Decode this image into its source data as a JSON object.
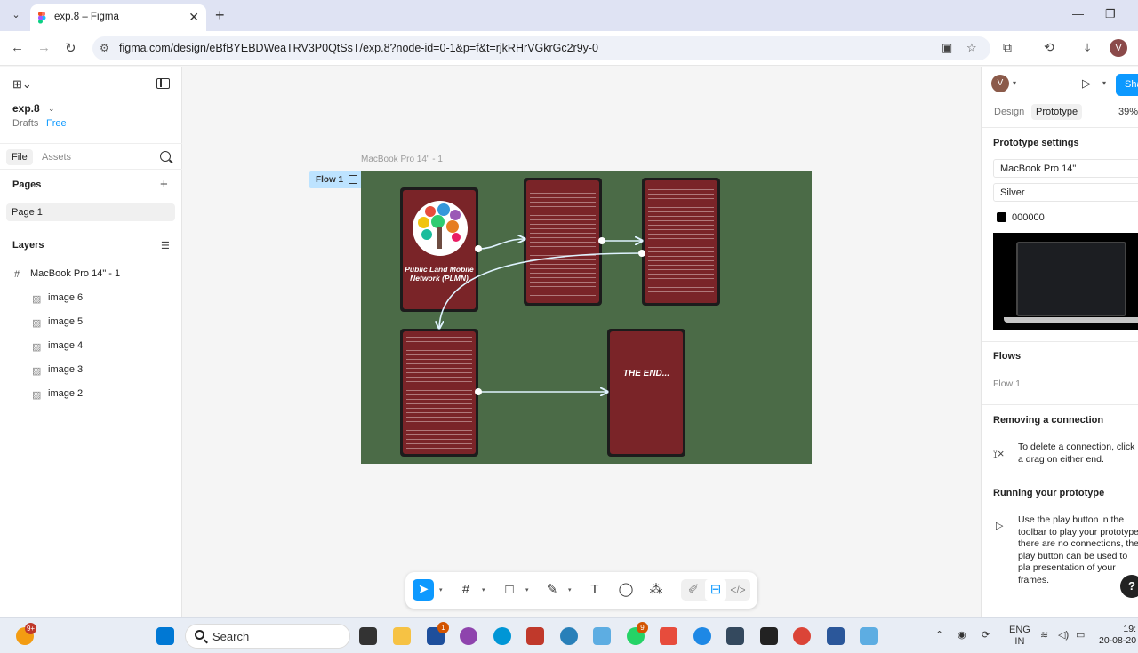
{
  "browser": {
    "tab_title": "exp.8 – Figma",
    "url": "figma.com/design/eBfBYEBDWeaTRV3P0QtSsT/exp.8?node-id=0-1&p=f&t=rjkRHrVGkrGc2r9y-0",
    "profile_initial": "V"
  },
  "left_panel": {
    "file_name": "exp.8",
    "drafts_label": "Drafts",
    "plan_badge": "Free",
    "tab_file": "File",
    "tab_assets": "Assets",
    "pages_heading": "Pages",
    "current_page": "Page 1",
    "layers_heading": "Layers",
    "layers": [
      {
        "name": "MacBook Pro 14\" - 1",
        "icon": "frame-icon"
      },
      {
        "name": "image 6",
        "icon": "image-icon"
      },
      {
        "name": "image 5",
        "icon": "image-icon"
      },
      {
        "name": "image 4",
        "icon": "image-icon"
      },
      {
        "name": "image 3",
        "icon": "image-icon"
      },
      {
        "name": "image 2",
        "icon": "image-icon"
      }
    ]
  },
  "canvas": {
    "frame_label": "MacBook Pro 14\" - 1",
    "flow_badge": "Flow 1",
    "frame_color": "#4b6b47",
    "screen_color": "#7a2428",
    "screens": {
      "title_screen": "Public Land Mobile Network (PLMN)",
      "end_screen": "THE END..."
    }
  },
  "right_panel": {
    "avatar_initial": "V",
    "share_label": "Sha",
    "tab_design": "Design",
    "tab_prototype": "Prototype",
    "zoom": "39%",
    "prototype_settings_heading": "Prototype settings",
    "device": "MacBook Pro 14\"",
    "device_model": "Silver",
    "background_color": "000000",
    "flows_heading": "Flows",
    "flow_item": "Flow 1",
    "removing_heading": "Removing a connection",
    "removing_text": "To delete a connection, click a drag on either end.",
    "running_heading": "Running your prototype",
    "running_text": "Use the play button in the toolbar to play your prototype. there are no connections, the play button can be used to pla presentation of your frames."
  },
  "taskbar": {
    "search_label": "Search",
    "lang_top": "ENG",
    "lang_bottom": "IN",
    "time": "19:",
    "date": "20-08-20",
    "notification_badge": "9+",
    "whatsapp_badge": "9",
    "store_badge": "1"
  }
}
